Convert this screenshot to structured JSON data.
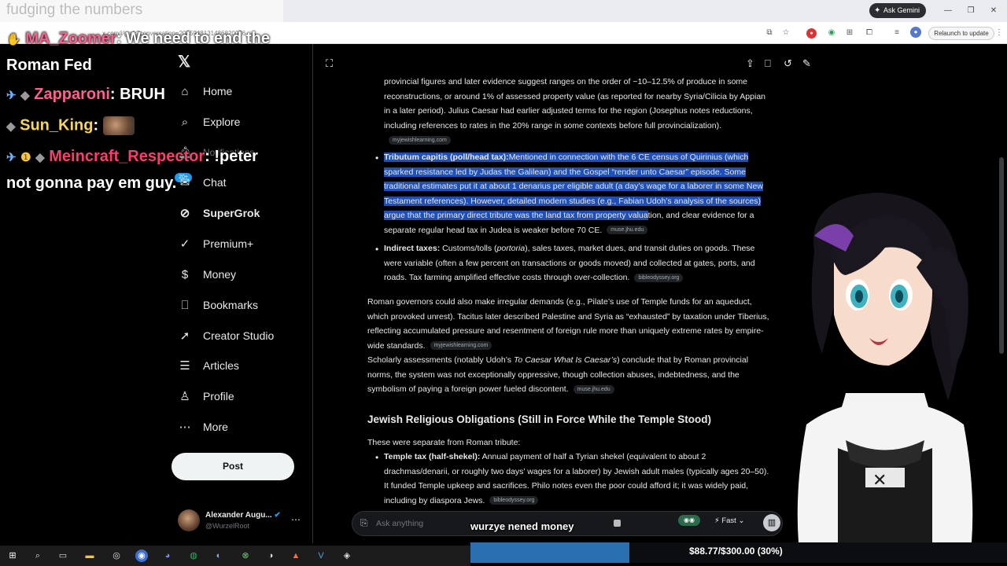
{
  "browser": {
    "url": "x.com/i/grok?conversation=2085948131486820076",
    "ask_gemini": "Ask Gemini",
    "relaunch": "Relaunch to update"
  },
  "stream_chat": {
    "top_line": "fudging the numbers",
    "lines": [
      {
        "user": "MA_Zoomer",
        "text": ": We need to end the"
      },
      {
        "user": "",
        "text": "Roman Fed"
      },
      {
        "user": "Zapparoni",
        "text": ": BRUH"
      },
      {
        "user": "Sun_King",
        "text": ":"
      },
      {
        "user": "Meincraft_Respector",
        "text": ": !peter"
      },
      {
        "user": "",
        "text": "not gonna pay em guy."
      }
    ],
    "overlay_message": "wurzye nened money"
  },
  "sidebar": {
    "items": [
      {
        "label": "Home",
        "icon": "home-icon"
      },
      {
        "label": "Explore",
        "icon": "search-icon"
      },
      {
        "label": "Notifications",
        "icon": "bell-icon",
        "badge": "20+"
      },
      {
        "label": "Chat",
        "icon": "chat-icon"
      },
      {
        "label": "SuperGrok",
        "icon": "grok-icon"
      },
      {
        "label": "Premium+",
        "icon": "premium-icon"
      },
      {
        "label": "Money",
        "icon": "money-icon"
      },
      {
        "label": "Bookmarks",
        "icon": "bookmark-icon"
      },
      {
        "label": "Creator Studio",
        "icon": "rocket-icon"
      },
      {
        "label": "Articles",
        "icon": "articles-icon"
      },
      {
        "label": "Profile",
        "icon": "profile-icon"
      },
      {
        "label": "More",
        "icon": "more-icon"
      }
    ],
    "post": "Post",
    "user": {
      "name": "Alexander Augu...",
      "handle": "@WurzelRoot"
    }
  },
  "content": {
    "intro": "provincial figures and later evidence suggest ranges on the order of ~10–12.5% of produce in some reconstructions, or around 1% of assessed property value (as reported for nearby Syria/Cilicia by Appian in a later period). Julius Caesar had earlier adjusted terms for the region (Josephus notes reductions, including references to rates in the 20% range in some contexts before full provincialization).",
    "src1": "myjewishlearning.com",
    "b1_head": "Tributum capitis (poll/head tax):",
    "b1_hl": "Mentioned in connection with the 6 CE census of Quirinius (which sparked resistance led by Judas the Galilean) and the Gospel “render unto Caesar” episode. Some traditional estimates put it at about 1 denarius per eligible adult (a day’s wage for a laborer in some New Testament references). However, detailed modern studies (e.g., Fabian Udoh’s analysis of the sources) argue that the primary direct tribute was the land tax from property valua",
    "b1_rest": "tion, and clear evidence for a separate regular head tax in Judea is weaker before 70 CE.",
    "src2": "muse.jhu.edu",
    "b2_head": "Indirect taxes:",
    "b2_text_a": " Customs/tolls (",
    "b2_em": "portoria",
    "b2_text_b": "), sales taxes, market dues, and transit duties on goods. These were variable (often a few percent on transactions or goods moved) and collected at gates, ports, and roads. Tax farming amplified effective costs through over-collection.",
    "src3": "bibleodyssey.org",
    "para2": "Roman governors could also make irregular demands (e.g., Pilate’s use of Temple funds for an aqueduct, which provoked unrest). Tacitus later described Palestine and Syria as “exhausted” by taxation under Tiberius, reflecting accumulated pressure and resentment of foreign rule more than uniquely extreme rates by empire-wide standards.",
    "src4": "myjewishlearning.com",
    "para3_a": "Scholarly assessments (notably Udoh’s ",
    "para3_em": "To Caesar What Is Caesar’s",
    "para3_b": ") conclude that by Roman provincial norms, the system was not exceptionally oppressive, though collection abuses, indebtedness, and the symbolism of paying a foreign power fueled discontent.",
    "src5": "muse.jhu.edu",
    "section_title": "Jewish Religious Obligations (Still in Force While the Temple Stood)",
    "section_intro": "These were separate from Roman tribute:",
    "b3_head": "Temple tax (half-shekel):",
    "b3_text": " Annual payment of half a Tyrian shekel (equivalent to about 2 drachmas/denarii, or roughly two days’ wages for a laborer) by Jewish adult males (typically ages 20–50). It funded Temple upkeep and sacrifices. Philo notes even the poor could afford it; it was widely paid, including by diaspora Jews.",
    "src6": "bibleodyssey.org"
  },
  "input": {
    "placeholder": "Ask anything",
    "mode": "Fast"
  },
  "donation": {
    "text": "$88.77/$300.00 (30%)",
    "progress": 0.296
  },
  "colors": {
    "accent": "#1d9bf0",
    "highlight": "#1f4fb8",
    "donation_fill": "#2a6fb0"
  }
}
